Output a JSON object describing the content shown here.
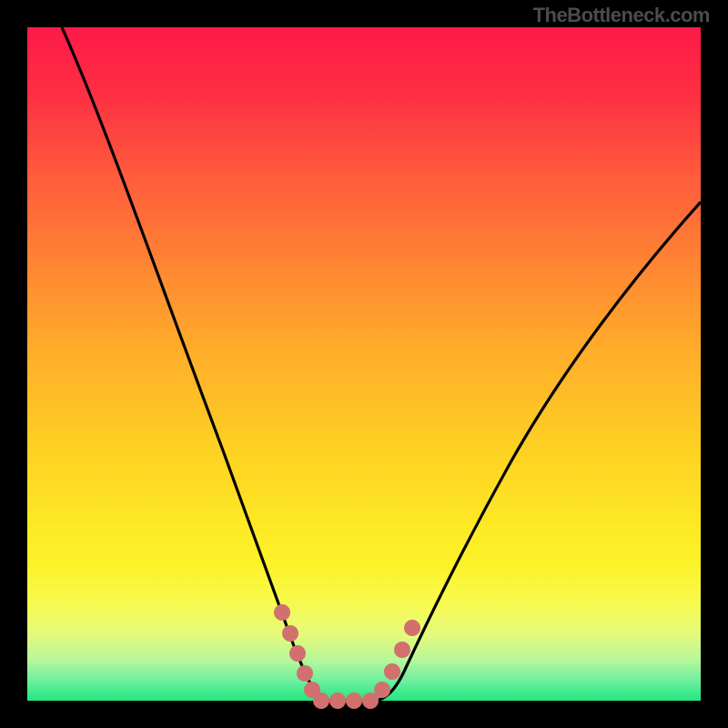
{
  "watermark": "TheBottleneck.com",
  "chart_data": {
    "type": "line",
    "title": "",
    "xlabel": "",
    "ylabel": "",
    "xlim": [
      0,
      1
    ],
    "ylim": [
      0,
      1
    ],
    "x": [
      0.0,
      0.02,
      0.04,
      0.06,
      0.08,
      0.1,
      0.12,
      0.14,
      0.16,
      0.18,
      0.2,
      0.22,
      0.24,
      0.26,
      0.28,
      0.3,
      0.32,
      0.34,
      0.36,
      0.38,
      0.4,
      0.42,
      0.44,
      0.46,
      0.48,
      0.5,
      0.52,
      0.54,
      0.56,
      0.58,
      0.6,
      0.62,
      0.64,
      0.66,
      0.68,
      0.7,
      0.72,
      0.74,
      0.76,
      0.78,
      0.8,
      0.82,
      0.84,
      0.86,
      0.88,
      0.9,
      0.92,
      0.94,
      0.96,
      0.98,
      1.0
    ],
    "values": [
      1.0,
      0.942,
      0.889,
      0.838,
      0.791,
      0.745,
      0.702,
      0.661,
      0.621,
      0.583,
      0.546,
      0.51,
      0.476,
      0.442,
      0.409,
      0.377,
      0.346,
      0.315,
      0.284,
      0.254,
      0.224,
      0.194,
      0.164,
      0.134,
      0.103,
      0.072,
      0.04,
      0.01,
      0.0,
      0.0,
      0.0,
      0.0,
      0.0,
      0.011,
      0.042,
      0.074,
      0.107,
      0.14,
      0.174,
      0.208,
      0.243,
      0.278,
      0.314,
      0.35,
      0.386,
      0.422,
      0.458,
      0.494,
      0.53,
      0.565,
      0.6
    ],
    "highlight_x_range": [
      0.34,
      0.488
    ],
    "highlight_y_range": [
      0.0,
      0.1
    ],
    "colors": {
      "gradient_top": "#fd1a48",
      "gradient_mid": "#fde924",
      "gradient_bottom": "#22e77e",
      "curve": "#000000",
      "highlight": "#d1706e"
    }
  }
}
